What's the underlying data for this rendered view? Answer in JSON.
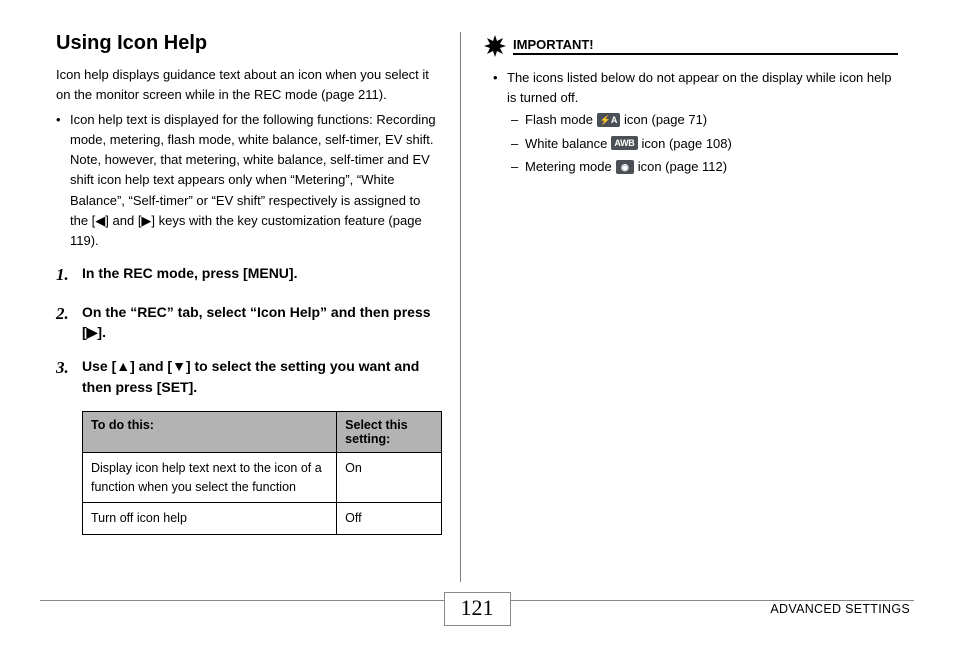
{
  "title": "Using Icon Help",
  "intro": "Icon help displays guidance text about an icon when you select it on the monitor screen while in the REC mode (page 211).",
  "bullet1": "Icon help text is displayed for the following functions: Recording mode, metering, flash mode, white balance, self-timer, EV shift. Note, however, that metering, white balance, self-timer and EV shift icon help text appears only when “Metering”, “White Balance”, “Self-timer” or “EV shift” respectively is assigned to the [◀] and [▶] keys with the key customization feature (page 119).",
  "steps": [
    {
      "num": "1.",
      "text": "In the REC mode, press [MENU]."
    },
    {
      "num": "2.",
      "text": "On the “REC” tab, select “Icon Help” and then press [▶]."
    },
    {
      "num": "3.",
      "text": "Use [▲] and [▼] to select the setting you want and then press [SET]."
    }
  ],
  "table": {
    "head": [
      "To do this:",
      "Select this setting:"
    ],
    "rows": [
      [
        "Display icon help text next to the icon of a function when you select the function",
        "On"
      ],
      [
        "Turn off icon help",
        "Off"
      ]
    ]
  },
  "important_label": "IMPORTANT!",
  "important_intro": "The icons listed below do not appear on the display while icon help is turned off.",
  "important_items": [
    {
      "pre": "Flash mode",
      "chip": "⚡A",
      "post": " icon (page 71)"
    },
    {
      "pre": "White balance",
      "chip": "AWB",
      "post": " icon (page 108)"
    },
    {
      "pre": "Metering mode",
      "chip": "◉",
      "post": " icon (page 112)"
    }
  ],
  "page_number": "121",
  "section": "ADVANCED SETTINGS"
}
